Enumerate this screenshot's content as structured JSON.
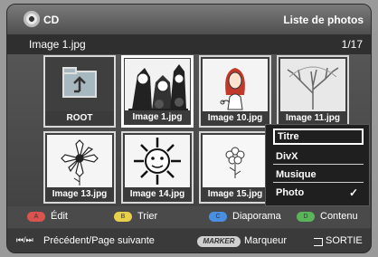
{
  "header": {
    "title": "CD",
    "section": "Liste de photos",
    "current_item": "Image 1.jpg",
    "page_counter": "1/17",
    "icon": "disc-icon"
  },
  "grid": {
    "tiles": [
      {
        "caption": "ROOT",
        "icon": "folder-up-icon",
        "selected": false
      },
      {
        "caption": "Image 1.jpg",
        "icon": "halloween-image-icon",
        "selected": true
      },
      {
        "caption": "Image 10.jpg",
        "icon": "woman-image-icon",
        "selected": false
      },
      {
        "caption": "Image 11.jpg",
        "icon": "tree-image-icon",
        "selected": false
      },
      {
        "caption": "Image 13.jpg",
        "icon": "flower-image-icon",
        "selected": false
      },
      {
        "caption": "Image 14.jpg",
        "icon": "sun-image-icon",
        "selected": false
      },
      {
        "caption": "Image 15.jpg",
        "icon": "flower-sketch-icon",
        "selected": false
      },
      {
        "caption": "",
        "icon": "",
        "selected": false
      }
    ]
  },
  "popup": {
    "items": [
      {
        "label": "Titre",
        "active": true,
        "checked": false
      },
      {
        "label": "DivX",
        "active": false,
        "checked": false
      },
      {
        "label": "Musique",
        "active": false,
        "checked": false
      },
      {
        "label": "Photo",
        "active": false,
        "checked": true
      }
    ],
    "check_mark": "✓"
  },
  "color_buttons": [
    {
      "key": "A",
      "label": "Édit",
      "color": "#d9534f"
    },
    {
      "key": "B",
      "label": "Trier",
      "color": "#e8d04a"
    },
    {
      "key": "C",
      "label": "Diaporama",
      "color": "#4a90e2"
    },
    {
      "key": "D",
      "label": "Contenu",
      "color": "#5ab55a"
    }
  ],
  "footer": {
    "nav_icon": "⏮/⏭",
    "nav_label": "Précédent/Page suivante",
    "marker_key": "MARKER",
    "marker_label": "Marqueur",
    "exit_icon": "exit-icon",
    "exit_label": "SORTIE"
  }
}
